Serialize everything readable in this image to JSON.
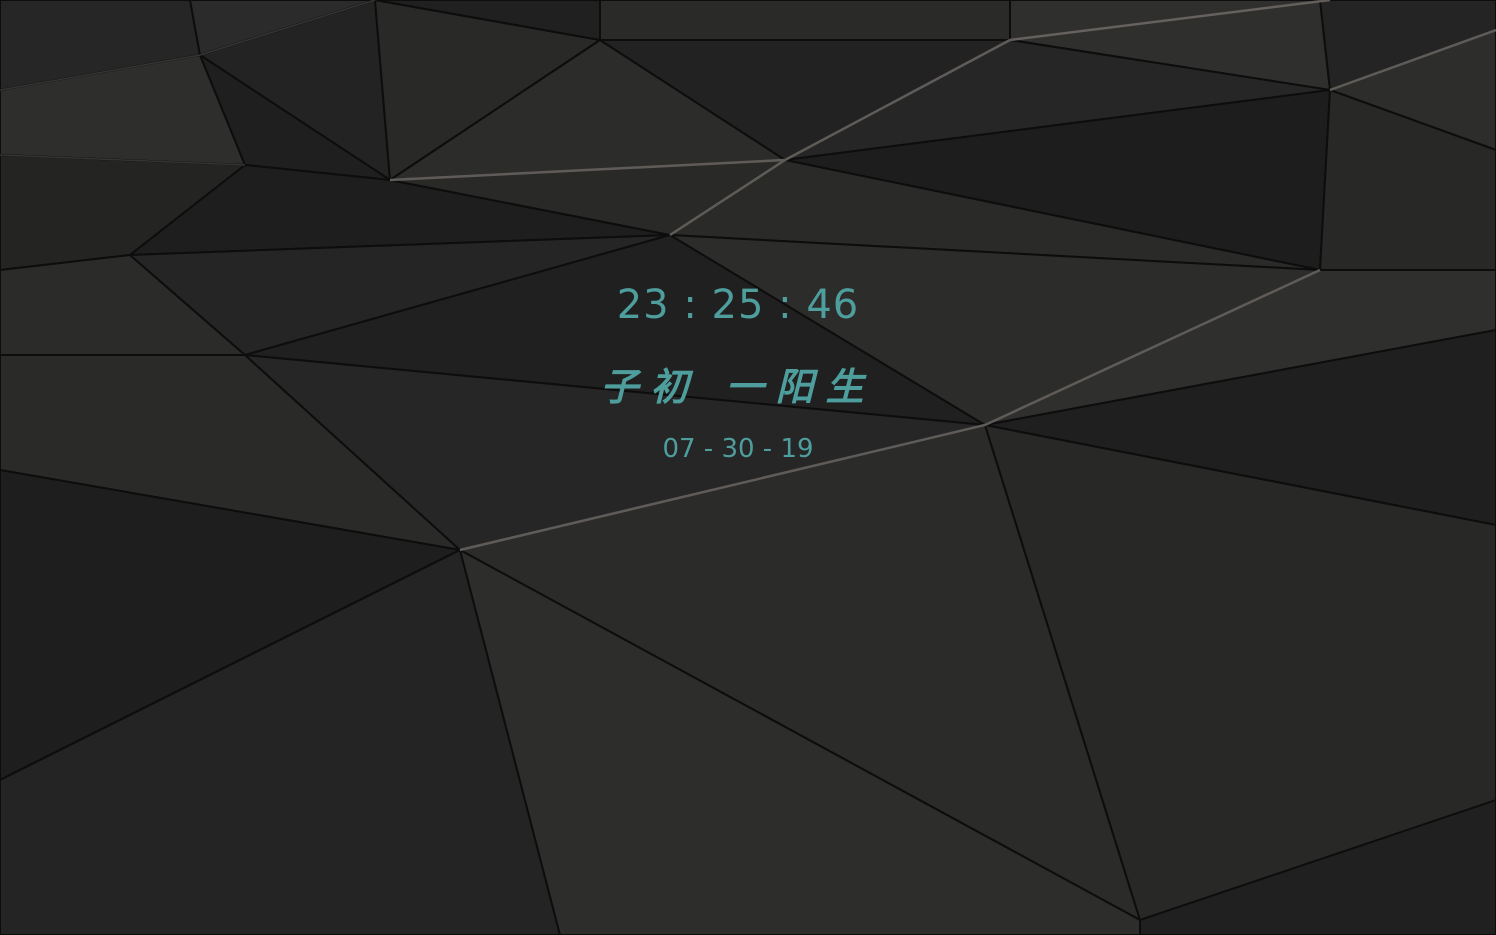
{
  "clock": {
    "time": "23 : 25 : 46",
    "shichen": "子初 一阳生",
    "date": "07 - 30 - 19",
    "color": "#4f9e9e"
  },
  "wallpaper": {
    "theme": "dark low-poly geometric",
    "base_color": "#1c1c1c",
    "edge_color": "#6e6a66"
  }
}
